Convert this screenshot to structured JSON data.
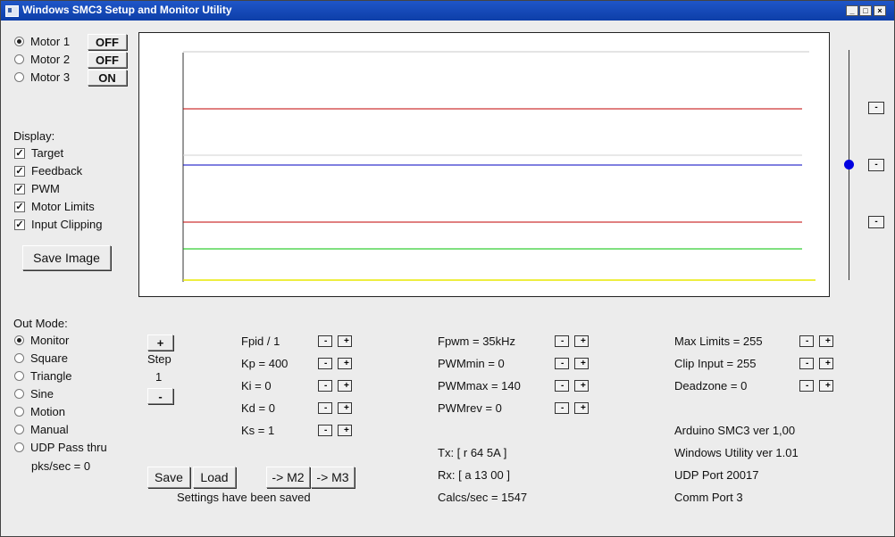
{
  "window": {
    "title": "Windows SMC3 Setup and Monitor Utility"
  },
  "motors": [
    {
      "label": "Motor 1",
      "selected": true,
      "state": "OFF"
    },
    {
      "label": "Motor 2",
      "selected": false,
      "state": "OFF"
    },
    {
      "label": "Motor 3",
      "selected": false,
      "state": "ON"
    }
  ],
  "display": {
    "heading": "Display:",
    "options": [
      {
        "label": "Target",
        "checked": true
      },
      {
        "label": "Feedback",
        "checked": true
      },
      {
        "label": "PWM",
        "checked": true
      },
      {
        "label": "Motor Limits",
        "checked": true
      },
      {
        "label": "Input Clipping",
        "checked": true
      }
    ],
    "save_image": "Save Image"
  },
  "plot": {
    "lines": [
      {
        "name": "top-gray",
        "color": "#c8c8c8"
      },
      {
        "name": "red-upper",
        "color": "#c00000"
      },
      {
        "name": "gray-mid",
        "color": "#d2d2d2"
      },
      {
        "name": "blue",
        "color": "#0000c0"
      },
      {
        "name": "red-lower",
        "color": "#c00000"
      },
      {
        "name": "green",
        "color": "#00c000"
      },
      {
        "name": "yellow",
        "color": "#e8e800"
      }
    ],
    "slider_minus": "-",
    "slider_color": "#0000e0"
  },
  "out_mode": {
    "heading": "Out Mode:",
    "options": [
      {
        "label": "Monitor",
        "selected": true
      },
      {
        "label": "Square",
        "selected": false
      },
      {
        "label": "Triangle",
        "selected": false
      },
      {
        "label": "Sine",
        "selected": false
      },
      {
        "label": "Motion",
        "selected": false
      },
      {
        "label": "Manual",
        "selected": false
      },
      {
        "label": "UDP Pass thru",
        "selected": false
      }
    ],
    "pks": "pks/sec = 0"
  },
  "step": {
    "plus": "+",
    "label": "Step",
    "value": "1",
    "minus": "-"
  },
  "pid": [
    {
      "label": "Fpid / 1"
    },
    {
      "label": "Kp = 400"
    },
    {
      "label": "Ki = 0"
    },
    {
      "label": "Kd = 0"
    },
    {
      "label": "Ks = 1"
    }
  ],
  "pwm": [
    {
      "label": "Fpwm = 35kHz"
    },
    {
      "label": "PWMmin = 0"
    },
    {
      "label": "PWMmax = 140"
    },
    {
      "label": "PWMrev = 0"
    }
  ],
  "limits": [
    {
      "label": "Max Limits = 255"
    },
    {
      "label": "Clip Input = 255"
    },
    {
      "label": "Deadzone = 0"
    }
  ],
  "buttons": {
    "save": "Save",
    "load": "Load",
    "to_m2": "-> M2",
    "to_m3": "-> M3",
    "minus": "-",
    "plus": "+"
  },
  "status": {
    "saved": "Settings have been saved",
    "tx": "Tx: [ r 64 5A ]",
    "rx": "Rx: [ a 13 00 ]",
    "calcs": "Calcs/sec = 1547"
  },
  "info": {
    "arduino": "Arduino SMC3 ver 1,00",
    "utility": "Windows Utility ver 1.01",
    "udp": "UDP Port 20017",
    "comm": "Comm Port 3"
  }
}
